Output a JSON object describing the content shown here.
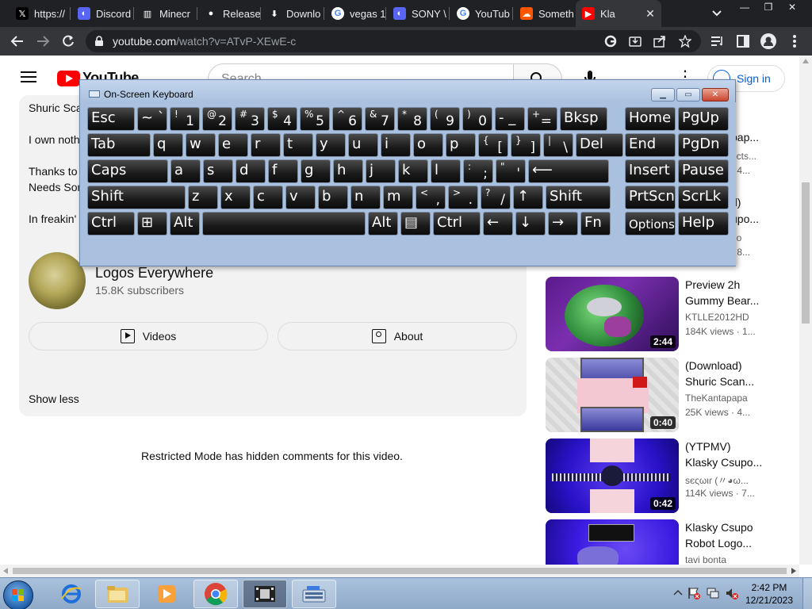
{
  "browser": {
    "tabs": [
      {
        "title": "https://",
        "icon": "x-icon"
      },
      {
        "title": "Discord",
        "icon": "discord-icon"
      },
      {
        "title": "Minecr",
        "icon": "museum-icon"
      },
      {
        "title": "Release",
        "icon": "github-icon"
      },
      {
        "title": "Downlo",
        "icon": "download-icon"
      },
      {
        "title": "vegas 1",
        "icon": "google-icon"
      },
      {
        "title": "SONY \\",
        "icon": "sony-icon"
      },
      {
        "title": "YouTub",
        "icon": "google-icon"
      },
      {
        "title": "Someth",
        "icon": "soundcloud-icon"
      },
      {
        "title": "Kla",
        "icon": "youtube-icon",
        "active": true
      }
    ],
    "new_tab": "+",
    "url_host": "youtube.com",
    "url_path": "/watch?v=ATvP-XEwE-c"
  },
  "youtube": {
    "logo_text": "YouTube",
    "search_placeholder": "Search",
    "sign_in": "Sign in",
    "description_lines": [
      "Shuric Sca",
      "I own noth",
      "Thanks to",
      "Needs Son",
      "In freakin'"
    ],
    "channel": {
      "name": "Logos Everywhere",
      "subscribers": "15.8K subscribers"
    },
    "videos_button": "Videos",
    "about_button": "About",
    "show_less": "Show less",
    "restricted_notice": "Restricted Mode has hidden comments for this video.",
    "partial_recs": [
      {
        "text": "pap..."
      },
      {
        "text": "ects..."
      },
      {
        "text": "· 4..."
      },
      {
        "text": "d)"
      },
      {
        "text": "upo..."
      },
      {
        "text": "no"
      },
      {
        "text": "· 8..."
      }
    ],
    "recommendations": [
      {
        "title": "Preview 2h Gummy Bear...",
        "channel": "KTLLE2012HD",
        "meta": "184K views · 1...",
        "duration": "2:44",
        "theme": "purple-gummy"
      },
      {
        "title": "(Download) Shuric Scan...",
        "channel": "TheKantapapa",
        "meta": "25K views · 4...",
        "duration": "0:40",
        "theme": "ds-console"
      },
      {
        "title": "(YTPMV) Klasky Csupo...",
        "channel": "ѕєςωιɾ (〃◕ω...",
        "meta": "114K views · 7...",
        "duration": "0:42",
        "theme": "blue-klasky"
      },
      {
        "title": "Klasky Csupo Robot Logo...",
        "channel": "tavi bonta",
        "meta": "",
        "duration": "",
        "theme": "klasky-robot"
      }
    ]
  },
  "osk": {
    "title": "On-Screen Keyboard",
    "rows": [
      [
        {
          "label": "Esc"
        },
        {
          "label": "~ `"
        },
        {
          "sup": "!",
          "main": "1"
        },
        {
          "sup": "@",
          "main": "2"
        },
        {
          "sup": "#",
          "main": "3"
        },
        {
          "sup": "$",
          "main": "4"
        },
        {
          "sup": "%",
          "main": "5"
        },
        {
          "sup": "^",
          "main": "6"
        },
        {
          "sup": "&",
          "main": "7"
        },
        {
          "sup": "*",
          "main": "8"
        },
        {
          "sup": "(",
          "main": "9"
        },
        {
          "sup": ")",
          "main": "0"
        },
        {
          "label": "- _"
        },
        {
          "sup": "+",
          "main": "="
        },
        {
          "label": "Bksp"
        },
        {
          "label": "Home"
        },
        {
          "label": "PgUp"
        }
      ],
      [
        {
          "label": "Tab"
        },
        {
          "label": "q"
        },
        {
          "label": "w"
        },
        {
          "label": "e"
        },
        {
          "label": "r"
        },
        {
          "label": "t"
        },
        {
          "label": "y"
        },
        {
          "label": "u"
        },
        {
          "label": "i"
        },
        {
          "label": "o"
        },
        {
          "label": "p"
        },
        {
          "sup": "{",
          "main": "["
        },
        {
          "sup": "}",
          "main": "]"
        },
        {
          "sup": "|",
          "main": "\\"
        },
        {
          "label": "Del"
        },
        {
          "label": "End"
        },
        {
          "label": "PgDn"
        }
      ],
      [
        {
          "label": "Caps"
        },
        {
          "label": "a"
        },
        {
          "label": "s"
        },
        {
          "label": "d"
        },
        {
          "label": "f"
        },
        {
          "label": "g"
        },
        {
          "label": "h"
        },
        {
          "label": "j"
        },
        {
          "label": "k"
        },
        {
          "label": "l"
        },
        {
          "sup": ":",
          "main": ";"
        },
        {
          "sup": "\"",
          "main": "'"
        },
        {
          "label": "⟵"
        },
        {
          "label": "Insert"
        },
        {
          "label": "Pause"
        }
      ],
      [
        {
          "label": "Shift"
        },
        {
          "label": "z"
        },
        {
          "label": "x"
        },
        {
          "label": "c"
        },
        {
          "label": "v"
        },
        {
          "label": "b"
        },
        {
          "label": "n"
        },
        {
          "label": "m"
        },
        {
          "sup": "<",
          "main": ","
        },
        {
          "sup": ">",
          "main": "."
        },
        {
          "sup": "?",
          "main": "/"
        },
        {
          "label": "↑"
        },
        {
          "label": "Shift"
        },
        {
          "label": "PrtScn"
        },
        {
          "label": "ScrLk"
        }
      ],
      [
        {
          "label": "Ctrl"
        },
        {
          "label": "⊞"
        },
        {
          "label": "Alt"
        },
        {
          "label": ""
        },
        {
          "label": "Alt"
        },
        {
          "label": "▤"
        },
        {
          "label": "Ctrl"
        },
        {
          "label": "←"
        },
        {
          "label": "↓"
        },
        {
          "label": "→"
        },
        {
          "label": "Fn"
        },
        {
          "label": "Options"
        },
        {
          "label": "Help"
        }
      ]
    ]
  },
  "taskbar": {
    "apps": [
      {
        "name": "internet-explorer-icon"
      },
      {
        "name": "file-explorer-icon"
      },
      {
        "name": "media-player-icon"
      },
      {
        "name": "chrome-icon"
      },
      {
        "name": "movie-maker-icon"
      },
      {
        "name": "on-screen-keyboard-icon"
      }
    ],
    "time": "2:42 PM",
    "date": "12/21/2023"
  }
}
